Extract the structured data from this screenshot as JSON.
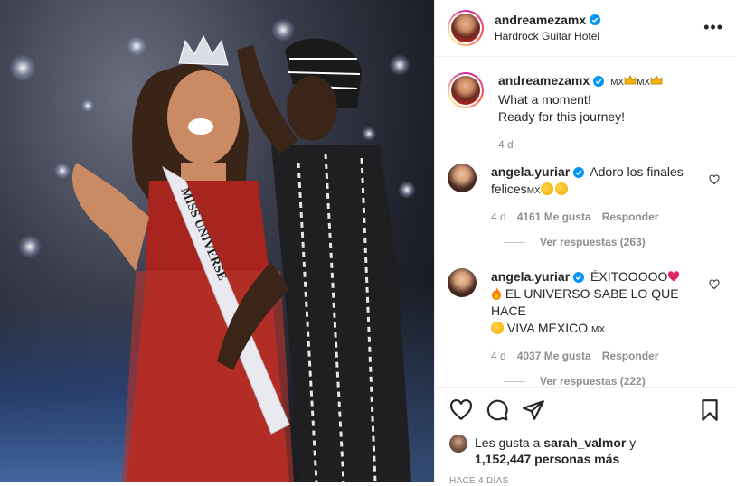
{
  "header": {
    "username": "andreamezamx",
    "location": "Hardrock Guitar Hotel",
    "more_label": "•••"
  },
  "caption": {
    "username": "andreamezamx",
    "flag1": "MX",
    "flag2": "MX",
    "line1": "What a moment!",
    "line2": "Ready for this journey!",
    "age": "4 d"
  },
  "comments": [
    {
      "username": "angela.yuriar",
      "text_a": "Adoro los finales felices",
      "flag": "MX",
      "age": "4 d",
      "likes": "4161 Me gusta",
      "reply": "Responder"
    },
    {
      "username": "angela.yuriar",
      "text_a": "ÉXITOOOOO",
      "text_b": "EL UNIVERSO SABE LO QUE HACE",
      "text_c": "VIVA MÉXICO",
      "flag": "MX",
      "age": "4 d",
      "likes": "4037 Me gusta",
      "reply": "Responder"
    }
  ],
  "view_replies": "Ver respuestas (263)",
  "hidden_replies": "Ver respuestas (222)",
  "likes_line": {
    "prefix": "Les gusta a",
    "user": "sarah_valmor",
    "conj": "y",
    "count": "1,152,447 personas más"
  },
  "timestamp": "HACE 4 DÍAS",
  "photo": {
    "sash_text": "MISS UNIVERSE"
  },
  "colors": {
    "verified": "#0095f6",
    "muted": "#8e8e8e",
    "text": "#262626"
  }
}
